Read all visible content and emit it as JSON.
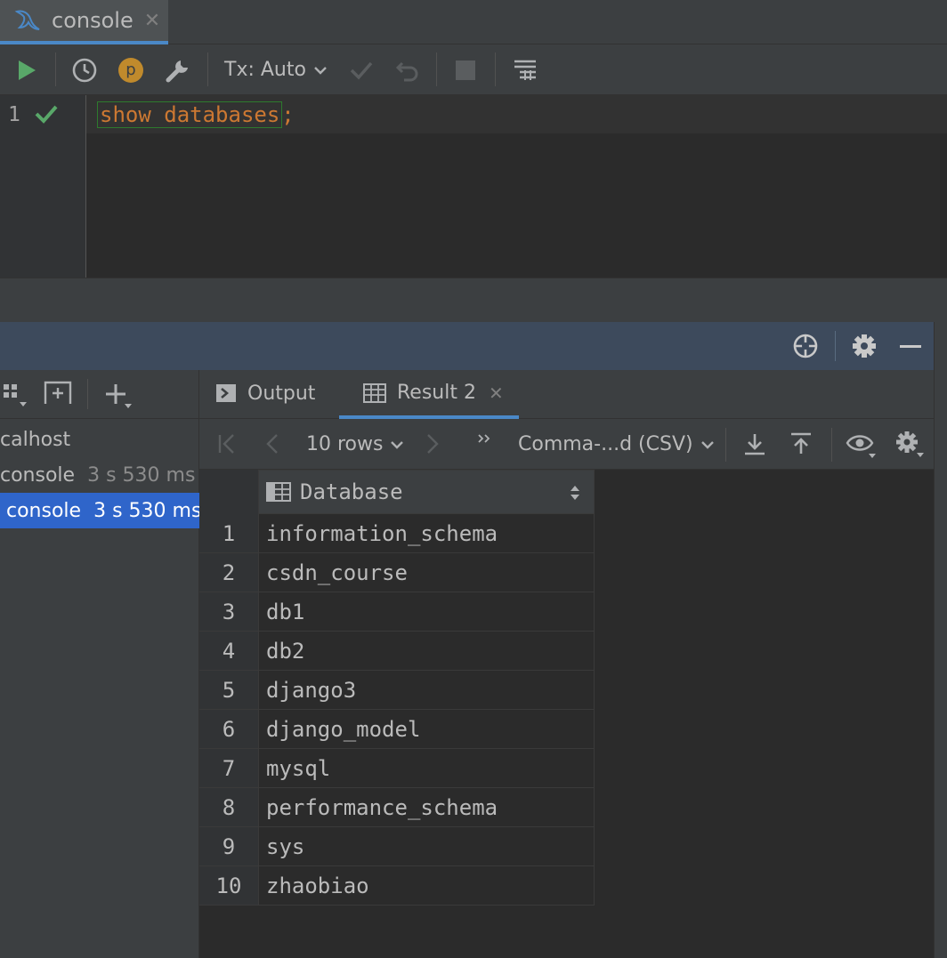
{
  "editor_tab": {
    "label": "console",
    "close": "✕"
  },
  "toolbar": {
    "profile_badge": "p",
    "tx_mode": "Tx: Auto"
  },
  "editor": {
    "line_number": "1",
    "sql_keyword": "show databases",
    "sql_end": ";"
  },
  "services": {
    "tree": [
      {
        "label": "calhost",
        "time": ""
      },
      {
        "label": "console",
        "time": "3 s 530 ms"
      },
      {
        "label": "console",
        "time": "3 s 530 ms"
      }
    ]
  },
  "results": {
    "tabs": [
      {
        "label": "Output"
      },
      {
        "label": "Result 2",
        "close": "✕"
      }
    ],
    "rows_label": "10 rows",
    "format_label": "Comma-...d (CSV)",
    "column_header": "Database",
    "rows": [
      {
        "n": "1",
        "value": "information_schema"
      },
      {
        "n": "2",
        "value": "csdn_course"
      },
      {
        "n": "3",
        "value": "db1"
      },
      {
        "n": "4",
        "value": "db2"
      },
      {
        "n": "5",
        "value": "django3"
      },
      {
        "n": "6",
        "value": "django_model"
      },
      {
        "n": "7",
        "value": "mysql"
      },
      {
        "n": "8",
        "value": "performance_schema"
      },
      {
        "n": "9",
        "value": "sys"
      },
      {
        "n": "10",
        "value": "zhaobiao"
      }
    ]
  },
  "colors": {
    "accent": "#4a88c7",
    "run": "#59a869",
    "keyword": "#cc7832",
    "selected": "#2f65ca"
  }
}
